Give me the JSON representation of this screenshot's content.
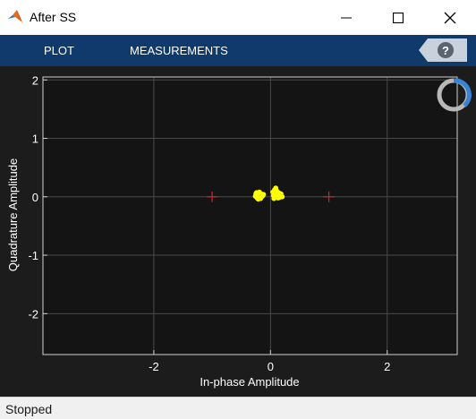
{
  "window": {
    "title": "After SS",
    "icon": "matlab-logo-icon"
  },
  "toolstrip": {
    "tabs": [
      "PLOT",
      "MEASUREMENTS"
    ],
    "help_icon": "help-icon"
  },
  "status": {
    "text": "Stopped"
  },
  "colors": {
    "toolstrip_bg": "#0f3a6b",
    "axes_bg": "#141414",
    "reference_marker": "#e02020",
    "samples": "#ffff00",
    "grid": "#4a4a4a"
  },
  "chart_data": {
    "type": "scatter",
    "title": "",
    "xlabel": "In-phase Amplitude",
    "ylabel": "Quadrature Amplitude",
    "xlim": [
      -3.9,
      3.2
    ],
    "ylim": [
      -2.7,
      2.05
    ],
    "x_ticks": [
      -2,
      0,
      2
    ],
    "y_ticks": [
      2,
      1,
      0,
      -1,
      -2
    ],
    "grid": true,
    "x_grid": [
      -2,
      0,
      2
    ],
    "y_grid": [
      2,
      1,
      0,
      -1,
      -2
    ],
    "series": [
      {
        "marker": "plus",
        "color": "#e02020",
        "points": [
          [
            -1,
            0
          ],
          [
            1,
            0
          ]
        ]
      },
      {
        "marker": "dot",
        "color": "#ffff00",
        "points": [
          [
            -0.25,
            0.05
          ],
          [
            -0.22,
            0.02
          ],
          [
            -0.2,
            0.06
          ],
          [
            -0.18,
            0.03
          ],
          [
            -0.15,
            0.0
          ],
          [
            -0.23,
            -0.02
          ],
          [
            -0.19,
            0.08
          ],
          [
            -0.16,
            0.05
          ],
          [
            -0.13,
            0.02
          ],
          [
            -0.21,
            -0.04
          ],
          [
            -0.26,
            0.01
          ],
          [
            -0.17,
            -0.03
          ],
          [
            -0.12,
            0.04
          ],
          [
            -0.24,
            0.07
          ],
          [
            0.05,
            0.02
          ],
          [
            0.08,
            0.06
          ],
          [
            0.1,
            0.0
          ],
          [
            0.12,
            0.04
          ],
          [
            0.15,
            0.01
          ],
          [
            0.07,
            0.12
          ],
          [
            0.09,
            0.15
          ],
          [
            0.11,
            0.09
          ],
          [
            0.14,
            0.07
          ],
          [
            0.17,
            0.02
          ],
          [
            0.06,
            -0.03
          ],
          [
            0.13,
            -0.02
          ],
          [
            0.18,
            0.05
          ],
          [
            0.04,
            0.08
          ],
          [
            0.16,
            -0.01
          ],
          [
            0.1,
            0.11
          ],
          [
            0.2,
            0.0
          ]
        ]
      }
    ]
  }
}
